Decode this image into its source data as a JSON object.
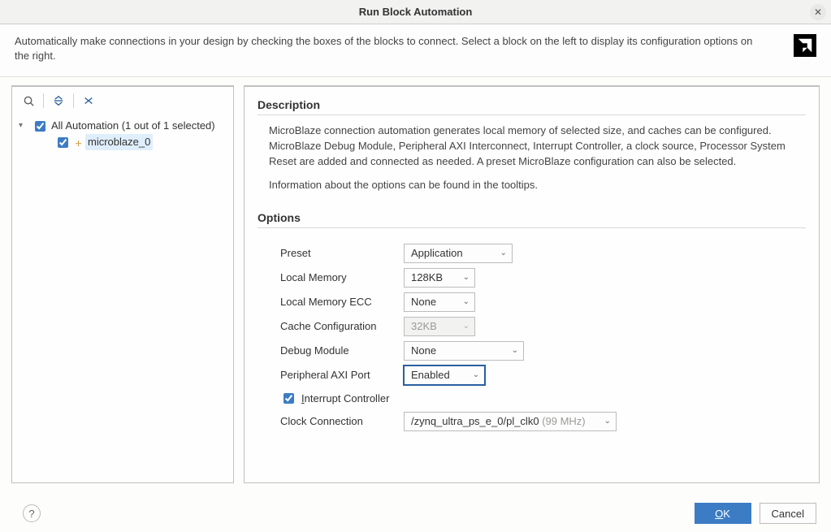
{
  "title": "Run Block Automation",
  "header_text": "Automatically make connections in your design by checking the boxes of the blocks to connect. Select a block on the left to display its configuration options on the right.",
  "tree": {
    "root_label": "All Automation (1 out of 1 selected)",
    "child_label": "microblaze_0"
  },
  "description": {
    "heading": "Description",
    "para1": "MicroBlaze connection automation generates local memory of selected size, and caches can be configured. MicroBlaze Debug Module, Peripheral AXI Interconnect, Interrupt Controller, a clock source, Processor System Reset are added and connected as needed. A preset MicroBlaze configuration can also be selected.",
    "para2": "Information about the options can be found in the tooltips."
  },
  "options": {
    "heading": "Options",
    "preset": {
      "label": "Preset",
      "value": "Application"
    },
    "local_memory": {
      "label": "Local Memory",
      "value": "128KB"
    },
    "local_memory_ecc": {
      "label": "Local Memory ECC",
      "value": "None"
    },
    "cache_config": {
      "label": "Cache Configuration",
      "value": "32KB"
    },
    "debug_module": {
      "label": "Debug Module",
      "value": "None"
    },
    "peripheral_axi": {
      "label": "Peripheral AXI Port",
      "value": "Enabled"
    },
    "interrupt_ctrl": {
      "label": "Interrupt Controller"
    },
    "clock_conn": {
      "label": "Clock Connection",
      "value": "/zynq_ultra_ps_e_0/pl_clk0",
      "freq": "(99 MHz)"
    }
  },
  "buttons": {
    "ok": "OK",
    "cancel": "Cancel"
  }
}
